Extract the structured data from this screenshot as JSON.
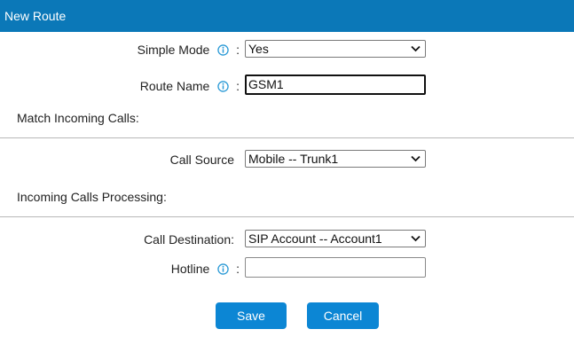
{
  "window": {
    "title": "New Route"
  },
  "form": {
    "simple_mode": {
      "label": "Simple Mode",
      "colon": ":",
      "value": "Yes"
    },
    "route_name": {
      "label": "Route Name",
      "colon": ":",
      "value": "GSM1"
    },
    "match_section": {
      "title": "Match Incoming Calls:"
    },
    "call_source": {
      "label": "Call Source",
      "value": "Mobile -- Trunk1"
    },
    "processing_section": {
      "title": "Incoming Calls Processing:"
    },
    "call_destination": {
      "label": "Call Destination:",
      "value": "SIP Account -- Account1"
    },
    "hotline": {
      "label": "Hotline",
      "colon": ":",
      "value": ""
    }
  },
  "buttons": {
    "save": "Save",
    "cancel": "Cancel"
  },
  "icons": {
    "info": "info-icon",
    "dropdown": "chevron-down-icon"
  },
  "colors": {
    "header": "#0b78b8",
    "button": "#0c86d4",
    "info_icon": "#2a9ad6"
  }
}
